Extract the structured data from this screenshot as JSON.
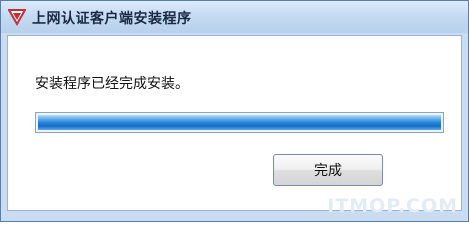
{
  "window": {
    "title": "上网认证客户端安装程序",
    "icon": "v-shield-icon"
  },
  "content": {
    "message": "安装程序已经完成安装。",
    "progress": 1.0
  },
  "buttons": {
    "finish_label": "完成"
  },
  "watermark": "ITMOP.COM",
  "colors": {
    "titlebar": "#c6dbf2",
    "progress_fill": "#1e7fd9",
    "icon_red": "#c0303a"
  }
}
